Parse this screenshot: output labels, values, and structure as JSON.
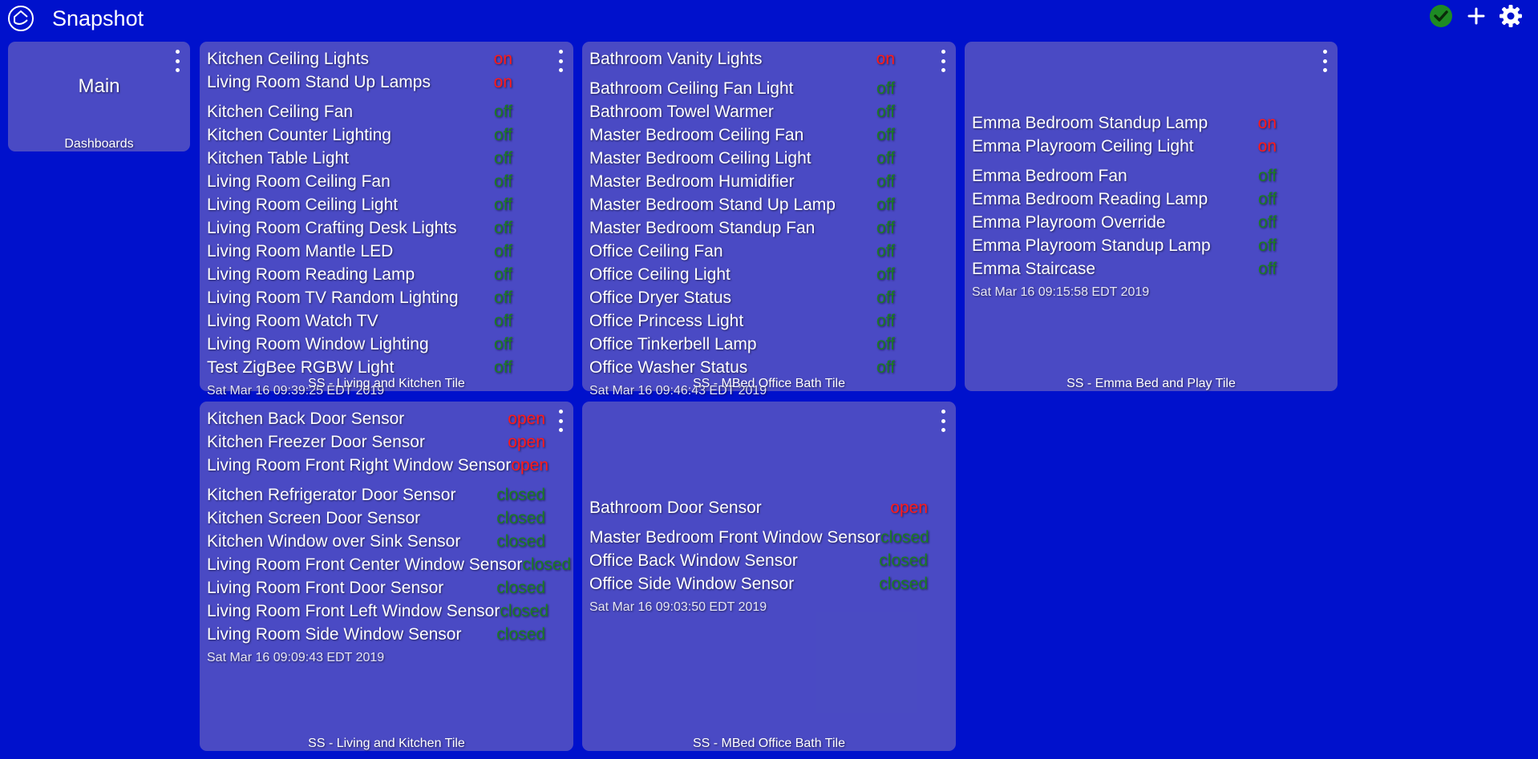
{
  "header": {
    "title": "Snapshot",
    "icons": [
      "home-icon",
      "check-circle-icon",
      "plus-icon",
      "gear-icon"
    ]
  },
  "colors": {
    "background": "#0011cc",
    "tile": "#7a6fbf",
    "status_on": "#ff1a1a",
    "status_off": "#1c7a25",
    "check": "#1e8a24"
  },
  "main_tile": {
    "title": "Main",
    "label": "Dashboards"
  },
  "tile_living_switches": {
    "label": "SS - Living and Kitchen Tile",
    "timestamp": "Sat Mar 16 09:39:25 EDT 2019",
    "devices": [
      {
        "name": "Kitchen Ceiling Lights",
        "state": "on"
      },
      {
        "name": "Living Room Stand Up Lamps",
        "state": "on"
      },
      {
        "name": "Kitchen Ceiling Fan",
        "state": "off"
      },
      {
        "name": "Kitchen Counter Lighting",
        "state": "off"
      },
      {
        "name": "Kitchen Table Light",
        "state": "off"
      },
      {
        "name": "Living Room Ceiling Fan",
        "state": "off"
      },
      {
        "name": "Living Room Ceiling Light",
        "state": "off"
      },
      {
        "name": "Living Room Crafting Desk Lights",
        "state": "off"
      },
      {
        "name": "Living Room Mantle LED",
        "state": "off"
      },
      {
        "name": "Living Room Reading Lamp",
        "state": "off"
      },
      {
        "name": "Living Room TV Random Lighting",
        "state": "off"
      },
      {
        "name": "Living Room Watch TV",
        "state": "off"
      },
      {
        "name": "Living Room Window Lighting",
        "state": "off"
      },
      {
        "name": "Test ZigBee RGBW Light",
        "state": "off"
      }
    ]
  },
  "tile_mbed_switches": {
    "label": "SS - MBed Office Bath Tile",
    "timestamp": "Sat Mar 16 09:46:43 EDT 2019",
    "devices": [
      {
        "name": "Bathroom Vanity Lights",
        "state": "on"
      },
      {
        "name": "Bathroom Ceiling Fan Light",
        "state": "off"
      },
      {
        "name": "Bathroom Towel Warmer",
        "state": "off"
      },
      {
        "name": "Master Bedroom Ceiling Fan",
        "state": "off"
      },
      {
        "name": "Master Bedroom Ceiling Light",
        "state": "off"
      },
      {
        "name": "Master Bedroom Humidifier",
        "state": "off"
      },
      {
        "name": "Master Bedroom Stand Up Lamp",
        "state": "off"
      },
      {
        "name": "Master Bedroom Standup Fan",
        "state": "off"
      },
      {
        "name": "Office Ceiling Fan",
        "state": "off"
      },
      {
        "name": "Office Ceiling Light",
        "state": "off"
      },
      {
        "name": "Office Dryer Status",
        "state": "off"
      },
      {
        "name": "Office Princess Light",
        "state": "off"
      },
      {
        "name": "Office Tinkerbell Lamp",
        "state": "off"
      },
      {
        "name": "Office Washer Status",
        "state": "off"
      }
    ]
  },
  "tile_emma_switches": {
    "label": "SS - Emma Bed and Play Tile",
    "timestamp": "Sat Mar 16 09:15:58 EDT 2019",
    "devices": [
      {
        "name": "Emma Bedroom Standup Lamp",
        "state": "on"
      },
      {
        "name": "Emma Playroom Ceiling Light",
        "state": "on"
      },
      {
        "name": "Emma Bedroom Fan",
        "state": "off"
      },
      {
        "name": "Emma Bedroom Reading Lamp",
        "state": "off"
      },
      {
        "name": "Emma Playroom Override",
        "state": "off"
      },
      {
        "name": "Emma Playroom Standup Lamp",
        "state": "off"
      },
      {
        "name": "Emma Staircase",
        "state": "off"
      }
    ]
  },
  "tile_living_contacts": {
    "label": "SS - Living and Kitchen Tile",
    "timestamp": "Sat Mar 16 09:09:43 EDT 2019",
    "devices": [
      {
        "name": "Kitchen Back Door Sensor",
        "state": "open"
      },
      {
        "name": "Kitchen Freezer Door Sensor",
        "state": "open"
      },
      {
        "name": "Living Room Front Right Window Sensor",
        "state": "open"
      },
      {
        "name": "Kitchen Refrigerator Door Sensor",
        "state": "closed"
      },
      {
        "name": "Kitchen Screen Door Sensor",
        "state": "closed"
      },
      {
        "name": "Kitchen Window over Sink Sensor",
        "state": "closed"
      },
      {
        "name": "Living Room Front Center Window Sensor",
        "state": "closed"
      },
      {
        "name": "Living Room Front Door Sensor",
        "state": "closed"
      },
      {
        "name": "Living Room Front Left Window Sensor",
        "state": "closed"
      },
      {
        "name": "Living Room Side Window Sensor",
        "state": "closed"
      }
    ]
  },
  "tile_mbed_contacts": {
    "label": "SS - MBed Office Bath Tile",
    "timestamp": "Sat Mar 16 09:03:50 EDT 2019",
    "devices": [
      {
        "name": "Bathroom Door Sensor",
        "state": "open"
      },
      {
        "name": "Master Bedroom Front Window Sensor",
        "state": "closed"
      },
      {
        "name": "Office Back Window Sensor",
        "state": "closed"
      },
      {
        "name": "Office Side Window Sensor",
        "state": "closed"
      }
    ]
  }
}
